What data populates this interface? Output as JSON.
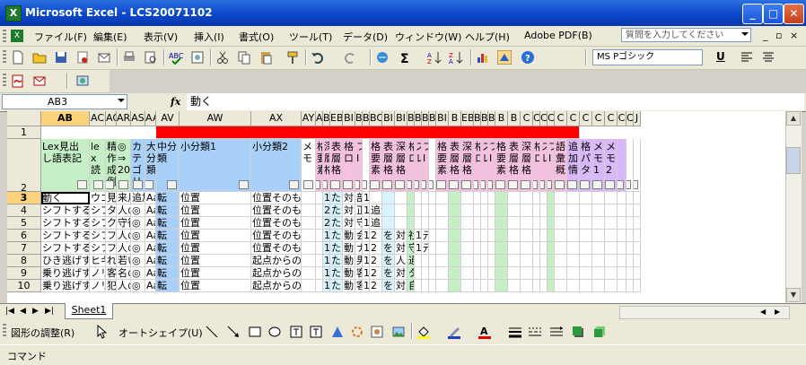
{
  "window": {
    "title": "Microsoft Excel - LCS20071102",
    "minimize": "_",
    "maximize": "□",
    "close": "✕"
  },
  "menu": {
    "items": [
      "ファイル(F)",
      "編集(E)",
      "表示(V)",
      "挿入(I)",
      "書式(O)",
      "ツール(T)",
      "データ(D)",
      "ウィンドウ(W)",
      "ヘルプ(H)",
      "Adobe PDF(B)"
    ],
    "help_placeholder": "質問を入力してください"
  },
  "toolbar": {
    "font_name": "MS Pゴシック",
    "underline": "U"
  },
  "formula_bar": {
    "name_box": "AB3",
    "fx": "fx",
    "content": "動く"
  },
  "sheet": {
    "columns": [
      {
        "label": "AB",
        "selected": true
      },
      {
        "label": "AC"
      },
      {
        "label": "AQ"
      },
      {
        "label": "AR"
      },
      {
        "label": "AS"
      },
      {
        "label": "AAI"
      },
      {
        "label": "AV"
      },
      {
        "label": "AW"
      },
      {
        "label": "AX"
      },
      {
        "label": "AY"
      },
      {
        "label": "A2B"
      },
      {
        "label": "BA"
      },
      {
        "label": "EB"
      },
      {
        "label": "BI"
      },
      {
        "label": "BI"
      },
      {
        "label": "B"
      },
      {
        "label": "BO"
      },
      {
        "label": "BI"
      },
      {
        "label": "BI"
      },
      {
        "label": "BI"
      },
      {
        "label": "B"
      },
      {
        "label": "BI"
      },
      {
        "label": "BI"
      },
      {
        "label": "BI"
      },
      {
        "label": "B"
      },
      {
        "label": "EB"
      },
      {
        "label": "BI"
      },
      {
        "label": "BU"
      },
      {
        "label": "B"
      },
      {
        "label": "B"
      },
      {
        "label": "B"
      },
      {
        "label": "C"
      },
      {
        "label": "C"
      },
      {
        "label": "C"
      },
      {
        "label": "C"
      },
      {
        "label": "C"
      },
      {
        "label": "C"
      },
      {
        "label": "C"
      },
      {
        "label": "C"
      },
      {
        "label": "C"
      },
      {
        "label": "C"
      },
      {
        "label": "C"
      },
      {
        "label": "J"
      }
    ],
    "rows": [
      "1",
      "2",
      "3",
      "4",
      "5",
      "6",
      "7",
      "8",
      "9",
      "10"
    ],
    "selected_row": "3",
    "header_row2": [
      "Lex見出し語表記",
      "lex読",
      "精作成例",
      "◎⇒20",
      "カテゴリ",
      "大分類",
      "中分類",
      "小分類1",
      "小分類2",
      "メモ",
      "格要素",
      "深層格",
      "表層格",
      "格ロ",
      "フI",
      "",
      "格要素",
      "表層格",
      "深層格",
      "格ロ",
      "スレ",
      "フI",
      "",
      "格要素",
      "表層格",
      "深層格",
      "格ロ",
      "スレ",
      "フI",
      "格要素",
      "表層格",
      "深層格",
      "格ロ",
      "スレ",
      "フI",
      "語彙概",
      "追加情",
      "格パタ",
      "メモ1",
      "メモ2",
      "",
      "",
      ""
    ],
    "data_rows": [
      [
        "動く",
        "ウゴ",
        "見",
        "来月",
        "追加",
        "Aa0",
        "転",
        "位置",
        "位置そのものの変化",
        "",
        "",
        "1",
        "たい",
        "対",
        "部",
        "1"
      ],
      [
        "シフトする",
        "シフ",
        "タ",
        "人の",
        "◎",
        "Aa0",
        "転",
        "位置",
        "位置そのものの変化",
        "",
        "",
        "2",
        "たい",
        "対",
        "正",
        "1",
        "追がok"
      ],
      [
        "シフトする",
        "シフ",
        "ク",
        "守役",
        "◎",
        "Aa0",
        "転",
        "位置",
        "位置そのものの変化",
        "",
        "",
        "2",
        "たい",
        "対",
        "守",
        "1",
        "追がok"
      ],
      [
        "シフトする",
        "シフ",
        "フ",
        "人の",
        "◎",
        "Aa0",
        "転",
        "位置",
        "位置そのものの変化",
        "",
        "",
        "1",
        "たい",
        "動",
        "会社が",
        "1",
        "2",
        "を",
        "対",
        "社",
        "1",
        "元がok"
      ],
      [
        "シフトする",
        "シフ",
        "フ",
        "人の",
        "◎",
        "Aa0",
        "転",
        "位置",
        "位置そのものの変化",
        "",
        "",
        "1",
        "たい",
        "動",
        "ナイン",
        "1",
        "2",
        "を",
        "対",
        "守",
        "1",
        "元がok"
      ],
      [
        "ひき逃げする",
        "ヒキ",
        "れ",
        "若い",
        "◎",
        "Aa0",
        "転",
        "位置",
        "起点からの逃亡",
        "",
        "",
        "1",
        "たい",
        "動",
        "男",
        "1",
        "2",
        "を",
        "人",
        "通行人を"
      ],
      [
        "乗り逃げする",
        "ノリ",
        "客",
        "名の",
        "◎",
        "Aa0",
        "転",
        "位置",
        "起点からの逃亡",
        "",
        "",
        "1",
        "たい",
        "動",
        "客",
        "1",
        "2",
        "を",
        "対",
        "タクシーを"
      ],
      [
        "乗り逃げする",
        "ノリ",
        "犯",
        "人の",
        "◎",
        "Aa0",
        "転",
        "位置",
        "起点からの逃亡",
        "",
        "",
        "1",
        "たい",
        "動",
        "客",
        "1",
        "2",
        "を",
        "対",
        "自転車を"
      ]
    ],
    "tab": "Sheet1"
  },
  "drawing_toolbar": {
    "adjust": "図形の調整(R)",
    "autoshape": "オートシェイプ(U)"
  },
  "status": {
    "text": "コマンド"
  }
}
